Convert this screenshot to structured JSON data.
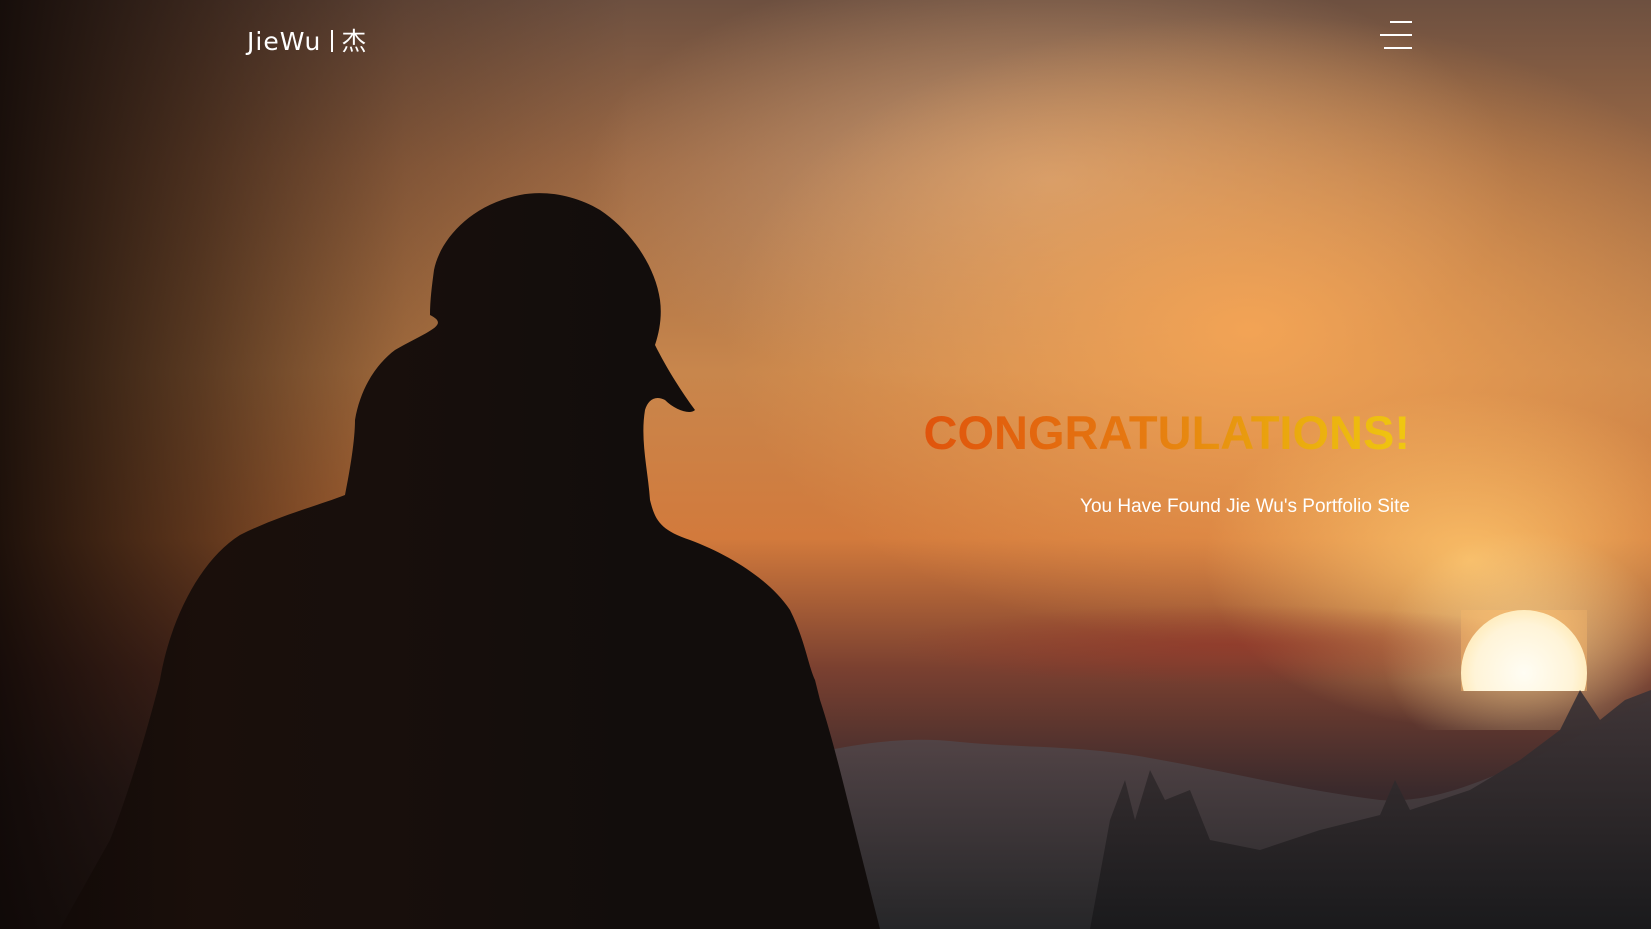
{
  "header": {
    "logo_text": "JieWu",
    "logo_chinese": "杰",
    "menu_icon": "hamburger-menu-icon"
  },
  "hero": {
    "title": "CONGRATULATIONS!",
    "subtitle": "You Have Found Jie Wu's Portfolio Site",
    "title_gradient": [
      "#e0540c",
      "#f0c810"
    ],
    "subtitle_color": "#ffffff"
  }
}
